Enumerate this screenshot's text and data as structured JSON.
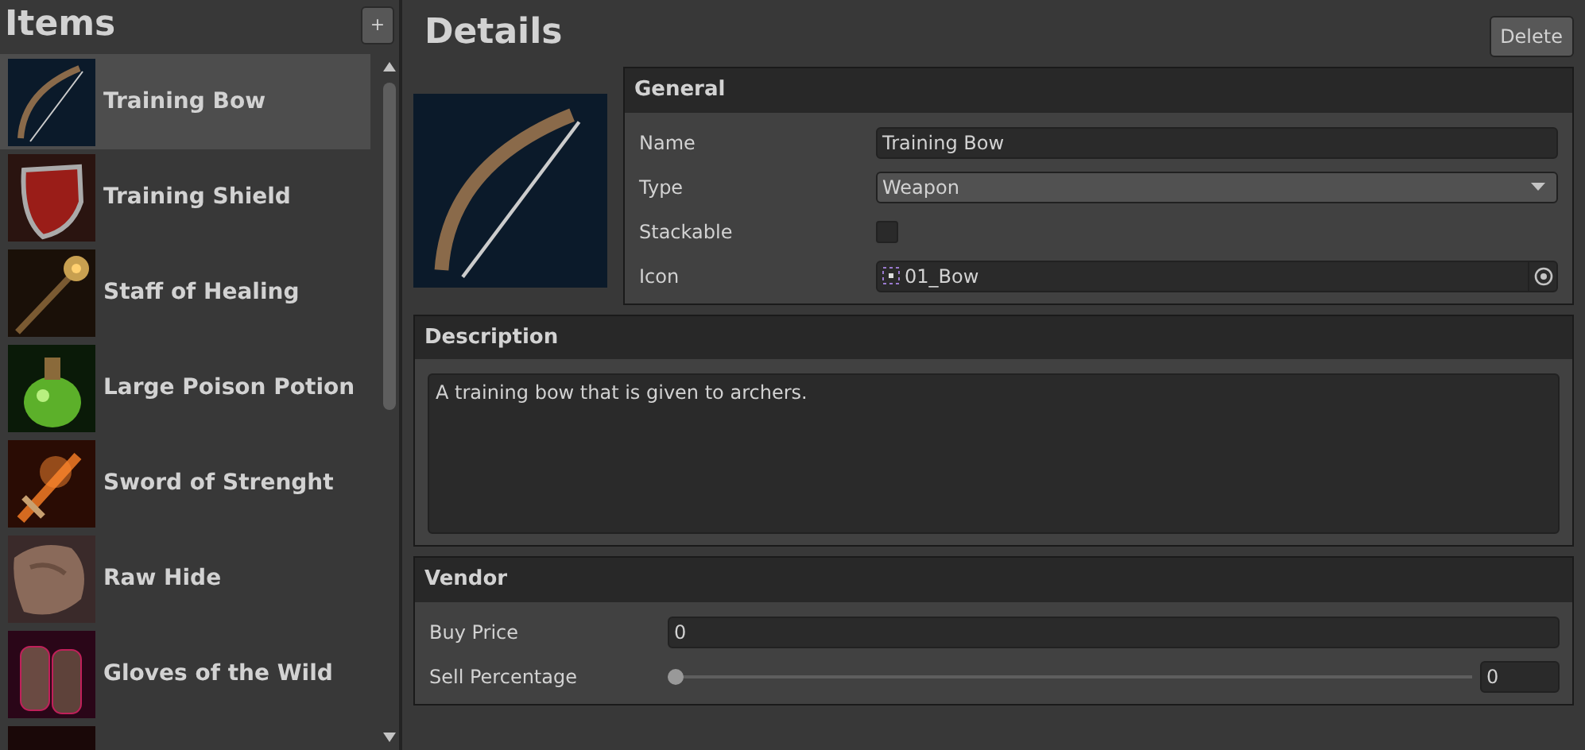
{
  "items_panel": {
    "title": "Items",
    "add_button": "+",
    "items": [
      {
        "name": "Training Bow",
        "selected": true
      },
      {
        "name": "Training Shield",
        "selected": false
      },
      {
        "name": "Staff of Healing",
        "selected": false
      },
      {
        "name": "Large Poison Potion",
        "selected": false
      },
      {
        "name": "Sword of Strenght",
        "selected": false
      },
      {
        "name": "Raw Hide",
        "selected": false
      },
      {
        "name": "Gloves of the Wild",
        "selected": false
      },
      {
        "selected": false
      }
    ]
  },
  "details": {
    "title": "Details",
    "delete_button": "Delete",
    "general": {
      "title": "General",
      "name_label": "Name",
      "name_value": "Training Bow",
      "type_label": "Type",
      "type_value": "Weapon",
      "stackable_label": "Stackable",
      "stackable_checked": false,
      "icon_label": "Icon",
      "icon_value": "01_Bow"
    },
    "description": {
      "title": "Description",
      "text": "A training bow that is given to archers."
    },
    "vendor": {
      "title": "Vendor",
      "buy_price_label": "Buy Price",
      "buy_price_value": "0",
      "sell_percentage_label": "Sell Percentage",
      "sell_percentage": {
        "level": 0,
        "value": "0"
      }
    }
  }
}
